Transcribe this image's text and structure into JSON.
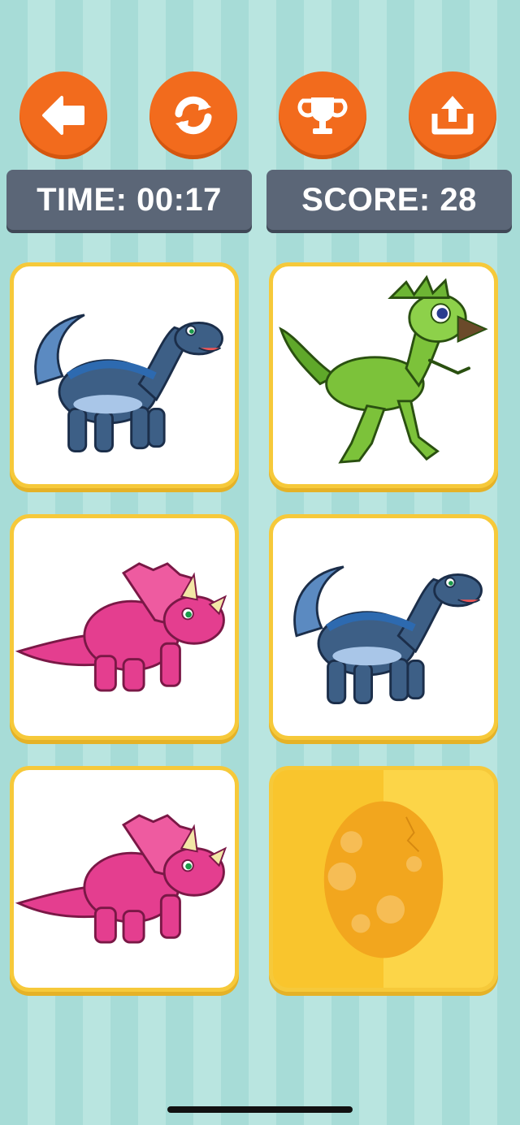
{
  "toolbar": {
    "back_icon": "arrow-left-icon",
    "restart_icon": "refresh-icon",
    "trophy_icon": "trophy-icon",
    "share_icon": "share-upload-icon",
    "button_color": "#f26b1d"
  },
  "stats": {
    "time_text": "TIME: 00:17",
    "score_text": "SCORE: 28"
  },
  "cards": [
    {
      "state": "face-up",
      "dino": "blue-brontosaurus"
    },
    {
      "state": "face-up",
      "dino": "green-raptor"
    },
    {
      "state": "face-up",
      "dino": "pink-triceratops"
    },
    {
      "state": "face-up",
      "dino": "blue-brontosaurus"
    },
    {
      "state": "face-up",
      "dino": "pink-triceratops"
    },
    {
      "state": "face-down",
      "dino": "egg"
    }
  ],
  "colors": {
    "card_border": "#f6c93a",
    "panel_bg": "#5b6677",
    "background_stripe_a": "#a7dcd7",
    "background_stripe_b": "#b9e5e0"
  }
}
